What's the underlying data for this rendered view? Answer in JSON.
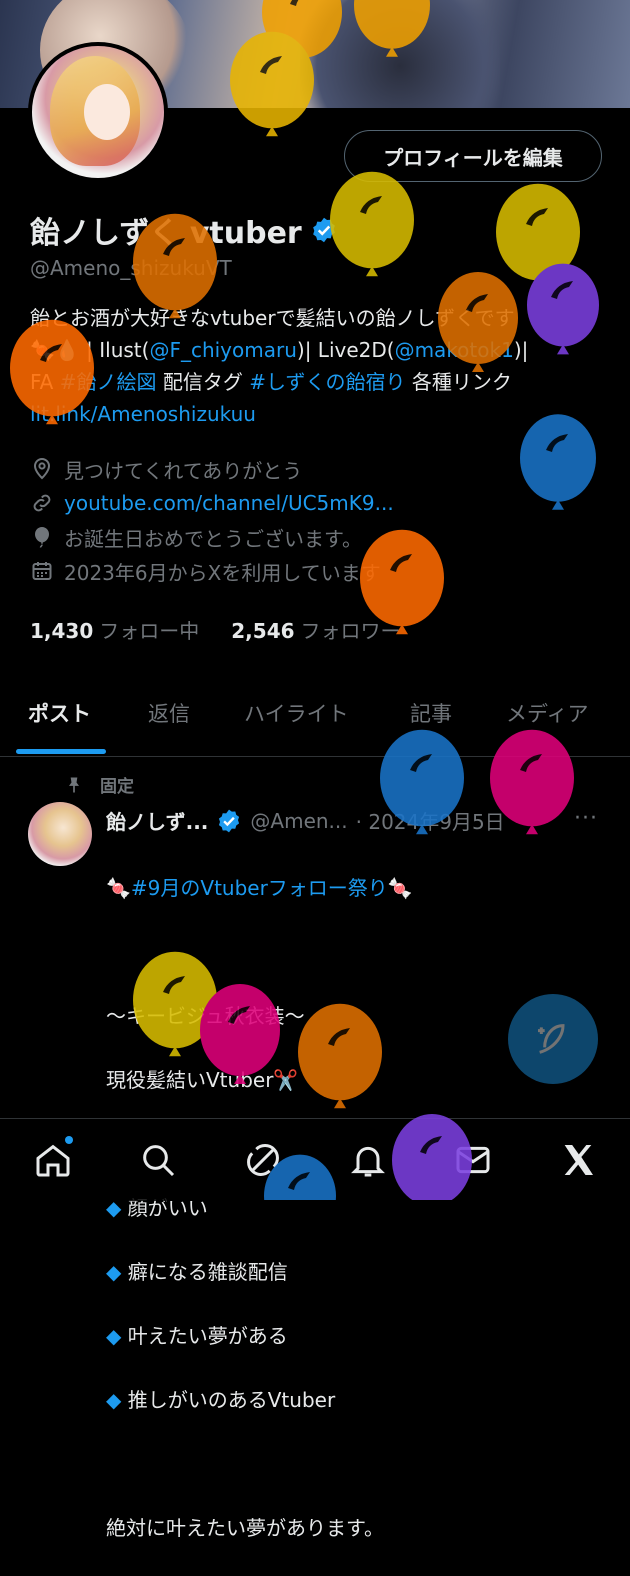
{
  "profile": {
    "edit_button": "プロフィールを編集",
    "display_name": "飴ノしずく vtuber",
    "handle": "@Ameno_shizukuVT",
    "bio": {
      "line1": "飴とお酒が大好きなvtuberで髪結いの飴ノしずくです",
      "line2_prefix": "🍬💧 | Ilust(",
      "line2_link1": "@F_chiyomaru",
      "line2_mid": ")| Live2D(",
      "line2_link2": "@makotok1",
      "line2_suffix": ")|",
      "line3_prefix": "FA ",
      "line3_tag1": "#飴ノ絵図",
      "line3_mid": " 配信タグ ",
      "line3_tag2": "#しずくの飴宿り",
      "line3_suffix": " 各種リンク",
      "line4_link": "lit.link/Amenoshizukuu"
    },
    "location": "見つけてくれてありがとう",
    "website": "youtube.com/channel/UC5mK9...",
    "birthday": "お誕生日おめでとうございます。",
    "joined": "2023年6月からXを利用しています",
    "following_count": "1,430",
    "following_label": "フォロー中",
    "followers_count": "2,546",
    "followers_label": "フォロワー"
  },
  "tabs": [
    "ポスト",
    "返信",
    "ハイライト",
    "記事",
    "メディア"
  ],
  "post": {
    "pinned_label": "固定",
    "author_name": "飴ノしず...",
    "author_handle": "@Amen...",
    "date": "· 2024年9月5日",
    "more": "···",
    "hashtag_line": "🍬#9月のVtuberフォロー祭り🍬",
    "line_blank": "",
    "line2": "〜キービジュ秋衣装〜",
    "line3": "現役髪結いVtuber✂️",
    "bullets": [
      "顔がいい",
      "癖になる雑談配信",
      "叶えたい夢がある",
      "推しがいのあるVtuber"
    ],
    "bullet_symbol": "◆",
    "line_last": "絶対に叶えたい夢があります。"
  },
  "icons": {
    "location": "location-pin-icon",
    "link": "link-icon",
    "birthday": "balloon-icon",
    "calendar": "calendar-icon",
    "pin": "pin-icon",
    "verified": "verified-badge-icon",
    "compose": "compose-icon",
    "home": "home-icon",
    "search": "search-icon",
    "grok": "grok-icon",
    "notifications": "bell-icon",
    "messages": "mail-icon",
    "x": "x-logo-icon"
  },
  "colors": {
    "accent": "#1d9bf0",
    "background": "#000000",
    "text": "#e7e9ea",
    "muted": "#71767b"
  },
  "balloons": [
    "#f0a000",
    "#e8b400",
    "#d8bc00",
    "#e07000",
    "#ff6a00",
    "#7b3fe0",
    "#1a73c8",
    "#e0007a"
  ]
}
